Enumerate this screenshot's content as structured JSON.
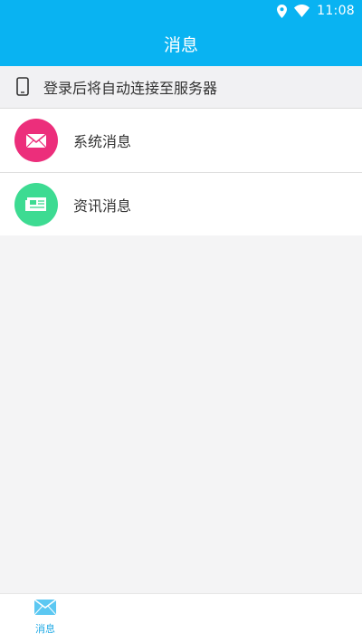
{
  "status_bar": {
    "time": "11:08",
    "icons": [
      "location-icon",
      "wifi-icon"
    ]
  },
  "app_bar": {
    "title": "消息"
  },
  "notice": {
    "icon": "phone-icon",
    "text": "登录后将自动连接至服务器"
  },
  "messages": {
    "items": [
      {
        "label": "系统消息",
        "icon": "envelope-icon",
        "color": "#ec2e7b"
      },
      {
        "label": "资讯消息",
        "icon": "newspaper-icon",
        "color": "#3ddb92"
      }
    ]
  },
  "bottom_nav": {
    "tabs": [
      {
        "label": "消息",
        "icon": "envelope-icon",
        "active": true,
        "color": "#1fa9e5"
      }
    ]
  },
  "colors": {
    "primary": "#09b3f2",
    "background": "#f4f4f5"
  }
}
